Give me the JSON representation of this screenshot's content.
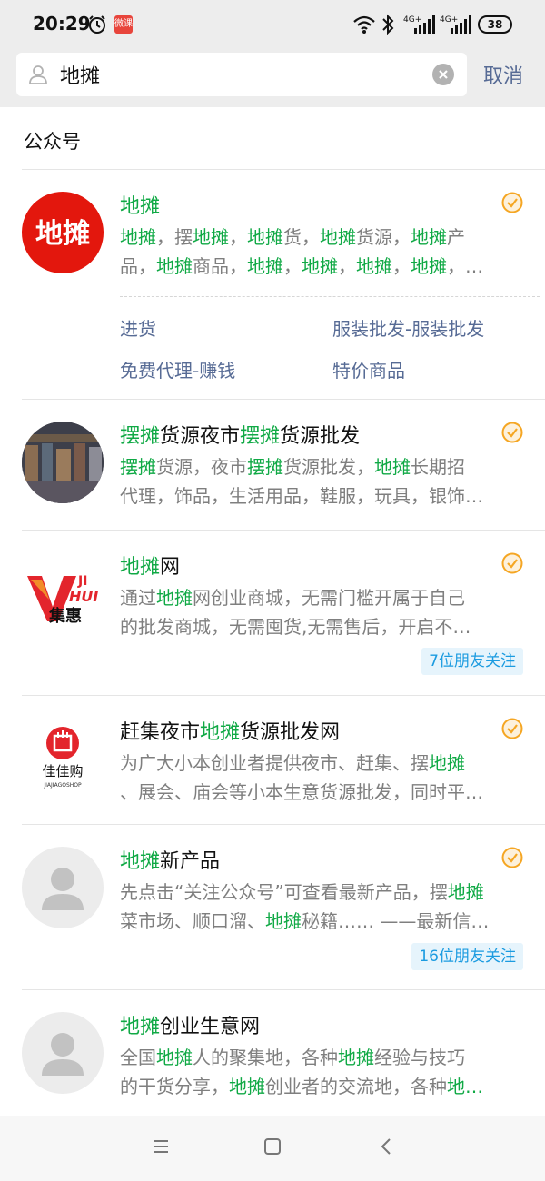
{
  "status_bar": {
    "time": "20:29",
    "app_badge": "微课",
    "battery": "38",
    "network1": "4G+",
    "network2": "4G+"
  },
  "search": {
    "value": "地摊",
    "cancel_label": "取消"
  },
  "section_title": "公众号",
  "results": [
    {
      "name": [
        {
          "t": "地摊",
          "h": true
        }
      ],
      "desc": [
        [
          {
            "t": "地摊",
            "h": true
          },
          {
            "t": "，摆",
            "h": false
          },
          {
            "t": "地摊",
            "h": true
          },
          {
            "t": "，",
            "h": false
          },
          {
            "t": "地摊",
            "h": true
          },
          {
            "t": "货，",
            "h": false
          },
          {
            "t": "地摊",
            "h": true
          },
          {
            "t": "货源，",
            "h": false
          },
          {
            "t": "地摊",
            "h": true
          },
          {
            "t": "产",
            "h": false
          }
        ],
        [
          {
            "t": "品，",
            "h": false
          },
          {
            "t": "地摊",
            "h": true
          },
          {
            "t": "商品，",
            "h": false
          },
          {
            "t": "地摊",
            "h": true
          },
          {
            "t": "，",
            "h": false
          },
          {
            "t": "地摊",
            "h": true
          },
          {
            "t": "，",
            "h": false
          },
          {
            "t": "地摊",
            "h": true
          },
          {
            "t": "，",
            "h": false
          },
          {
            "t": "地摊",
            "h": true
          },
          {
            "t": "，…",
            "h": false
          }
        ]
      ],
      "avatar_text": "地摊",
      "menu": [
        "进货",
        "服装批发-服装批发",
        "免费代理-赚钱",
        "特价商品"
      ]
    },
    {
      "name": [
        {
          "t": "摆摊",
          "h": true
        },
        {
          "t": "货源夜市",
          "h": false
        },
        {
          "t": "摆摊",
          "h": true
        },
        {
          "t": "货源批发",
          "h": false
        }
      ],
      "desc": [
        [
          {
            "t": "摆摊",
            "h": true
          },
          {
            "t": "货源，夜市",
            "h": false
          },
          {
            "t": "摆摊",
            "h": true
          },
          {
            "t": "货源批发，",
            "h": false
          },
          {
            "t": "地摊",
            "h": true
          },
          {
            "t": "长期招",
            "h": false
          }
        ],
        [
          {
            "t": "代理，饰品，生活用品，鞋服，玩具，银饰…",
            "h": false
          }
        ]
      ]
    },
    {
      "name": [
        {
          "t": "地摊",
          "h": true
        },
        {
          "t": "网",
          "h": false
        }
      ],
      "desc": [
        [
          {
            "t": "通过",
            "h": false
          },
          {
            "t": "地摊",
            "h": true
          },
          {
            "t": "网创业商城，无需门槛开属于自己",
            "h": false
          }
        ],
        [
          {
            "t": "的批发商城，无需囤货,无需售后，开启不…",
            "h": false
          }
        ]
      ],
      "avatar_text_top": "JI",
      "avatar_text_mid": "HUI",
      "avatar_text_bottom": "集惠",
      "friends": "7位朋友关注"
    },
    {
      "name": [
        {
          "t": "赶集夜市",
          "h": false
        },
        {
          "t": "地摊",
          "h": true
        },
        {
          "t": "货源批发网",
          "h": false
        }
      ],
      "desc": [
        [
          {
            "t": "为广大小本创业者提供夜市、赶集、摆",
            "h": false
          },
          {
            "t": "地摊",
            "h": true
          }
        ],
        [
          {
            "t": "、展会、庙会等小本生意货源批发，同时平…",
            "h": false
          }
        ]
      ],
      "avatar_text": "佳佳购",
      "avatar_sub": "JIAJIAGOSHOP"
    },
    {
      "name": [
        {
          "t": "地摊",
          "h": true
        },
        {
          "t": "新产品",
          "h": false
        }
      ],
      "desc": [
        [
          {
            "t": "先点击“关注公众号”可查看最新产品，摆",
            "h": false
          },
          {
            "t": "地摊",
            "h": true
          }
        ],
        [
          {
            "t": "菜市场、顺口溜、",
            "h": false
          },
          {
            "t": "地摊",
            "h": true
          },
          {
            "t": "秘籍…… ——最新信…",
            "h": false
          }
        ]
      ],
      "friends": "16位朋友关注"
    },
    {
      "name": [
        {
          "t": "地摊",
          "h": true
        },
        {
          "t": "创业生意网",
          "h": false
        }
      ],
      "desc": [
        [
          {
            "t": "全国",
            "h": false
          },
          {
            "t": "地摊",
            "h": true
          },
          {
            "t": "人的聚集地，各种",
            "h": false
          },
          {
            "t": "地摊",
            "h": true
          },
          {
            "t": "经验与技巧",
            "h": false
          }
        ],
        [
          {
            "t": "的干货分享，",
            "h": false
          },
          {
            "t": "地摊",
            "h": true
          },
          {
            "t": "创业者的交流地，各种",
            "h": false
          },
          {
            "t": "地…",
            "h": true
          }
        ]
      ]
    }
  ],
  "colors": {
    "highlight": "#10a945",
    "link": "#576b95",
    "verify": "#f5a623",
    "friends_text": "#1b9be0"
  }
}
